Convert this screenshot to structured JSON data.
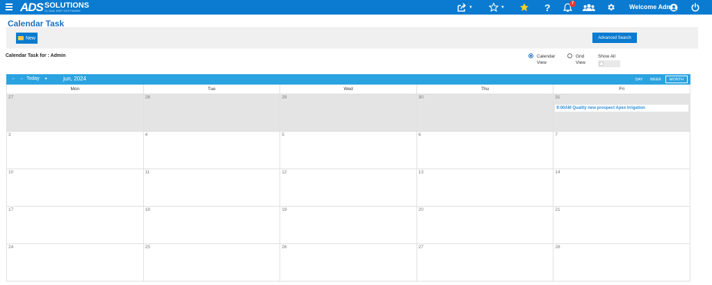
{
  "topbar": {
    "logo_main": "ADS",
    "logo_sub": "SOLUTIONS",
    "logo_tag": "CLOUD ERP SOFTWARE",
    "notification_count": "7",
    "welcome_text": "Welcome Admin",
    "icons": [
      "menu-icon",
      "share-icon",
      "star-outline-icon",
      "star-filled-icon",
      "help-icon",
      "bell-icon",
      "users-icon",
      "gear-icon",
      "user-circle-icon",
      "power-icon"
    ],
    "accent": "#0a7bd0"
  },
  "page": {
    "title": "Calendar Task",
    "new_label": "New",
    "advanced_search_label": "Advanced Search",
    "for_label": "Calendar Task for : Admin"
  },
  "view_options": {
    "calendar_line1": "Calendar",
    "calendar_line2": "View",
    "grid_line1": "Grid",
    "grid_line2": "View",
    "selected": "calendar",
    "show_all_label": "Show All"
  },
  "calendar": {
    "today_label": "Today",
    "month_label": "jun, 2024",
    "view_buttons": [
      "DAY",
      "WEEK",
      "MONTH"
    ],
    "active_view": "MONTH",
    "weekdays": [
      "Mon",
      "Tue",
      "Wed",
      "Thu",
      "Fri"
    ],
    "weeks": [
      [
        "27",
        "28",
        "29",
        "30",
        "31"
      ],
      [
        "3",
        "4",
        "5",
        "6",
        "7"
      ],
      [
        "10",
        "11",
        "12",
        "13",
        "14"
      ],
      [
        "17",
        "18",
        "19",
        "20",
        "21"
      ],
      [
        "24",
        "25",
        "26",
        "27",
        "28"
      ]
    ],
    "event": {
      "text": "9:00AM Quality new prospect Apex Irrigation"
    },
    "header_color": "#2ba3e0"
  }
}
